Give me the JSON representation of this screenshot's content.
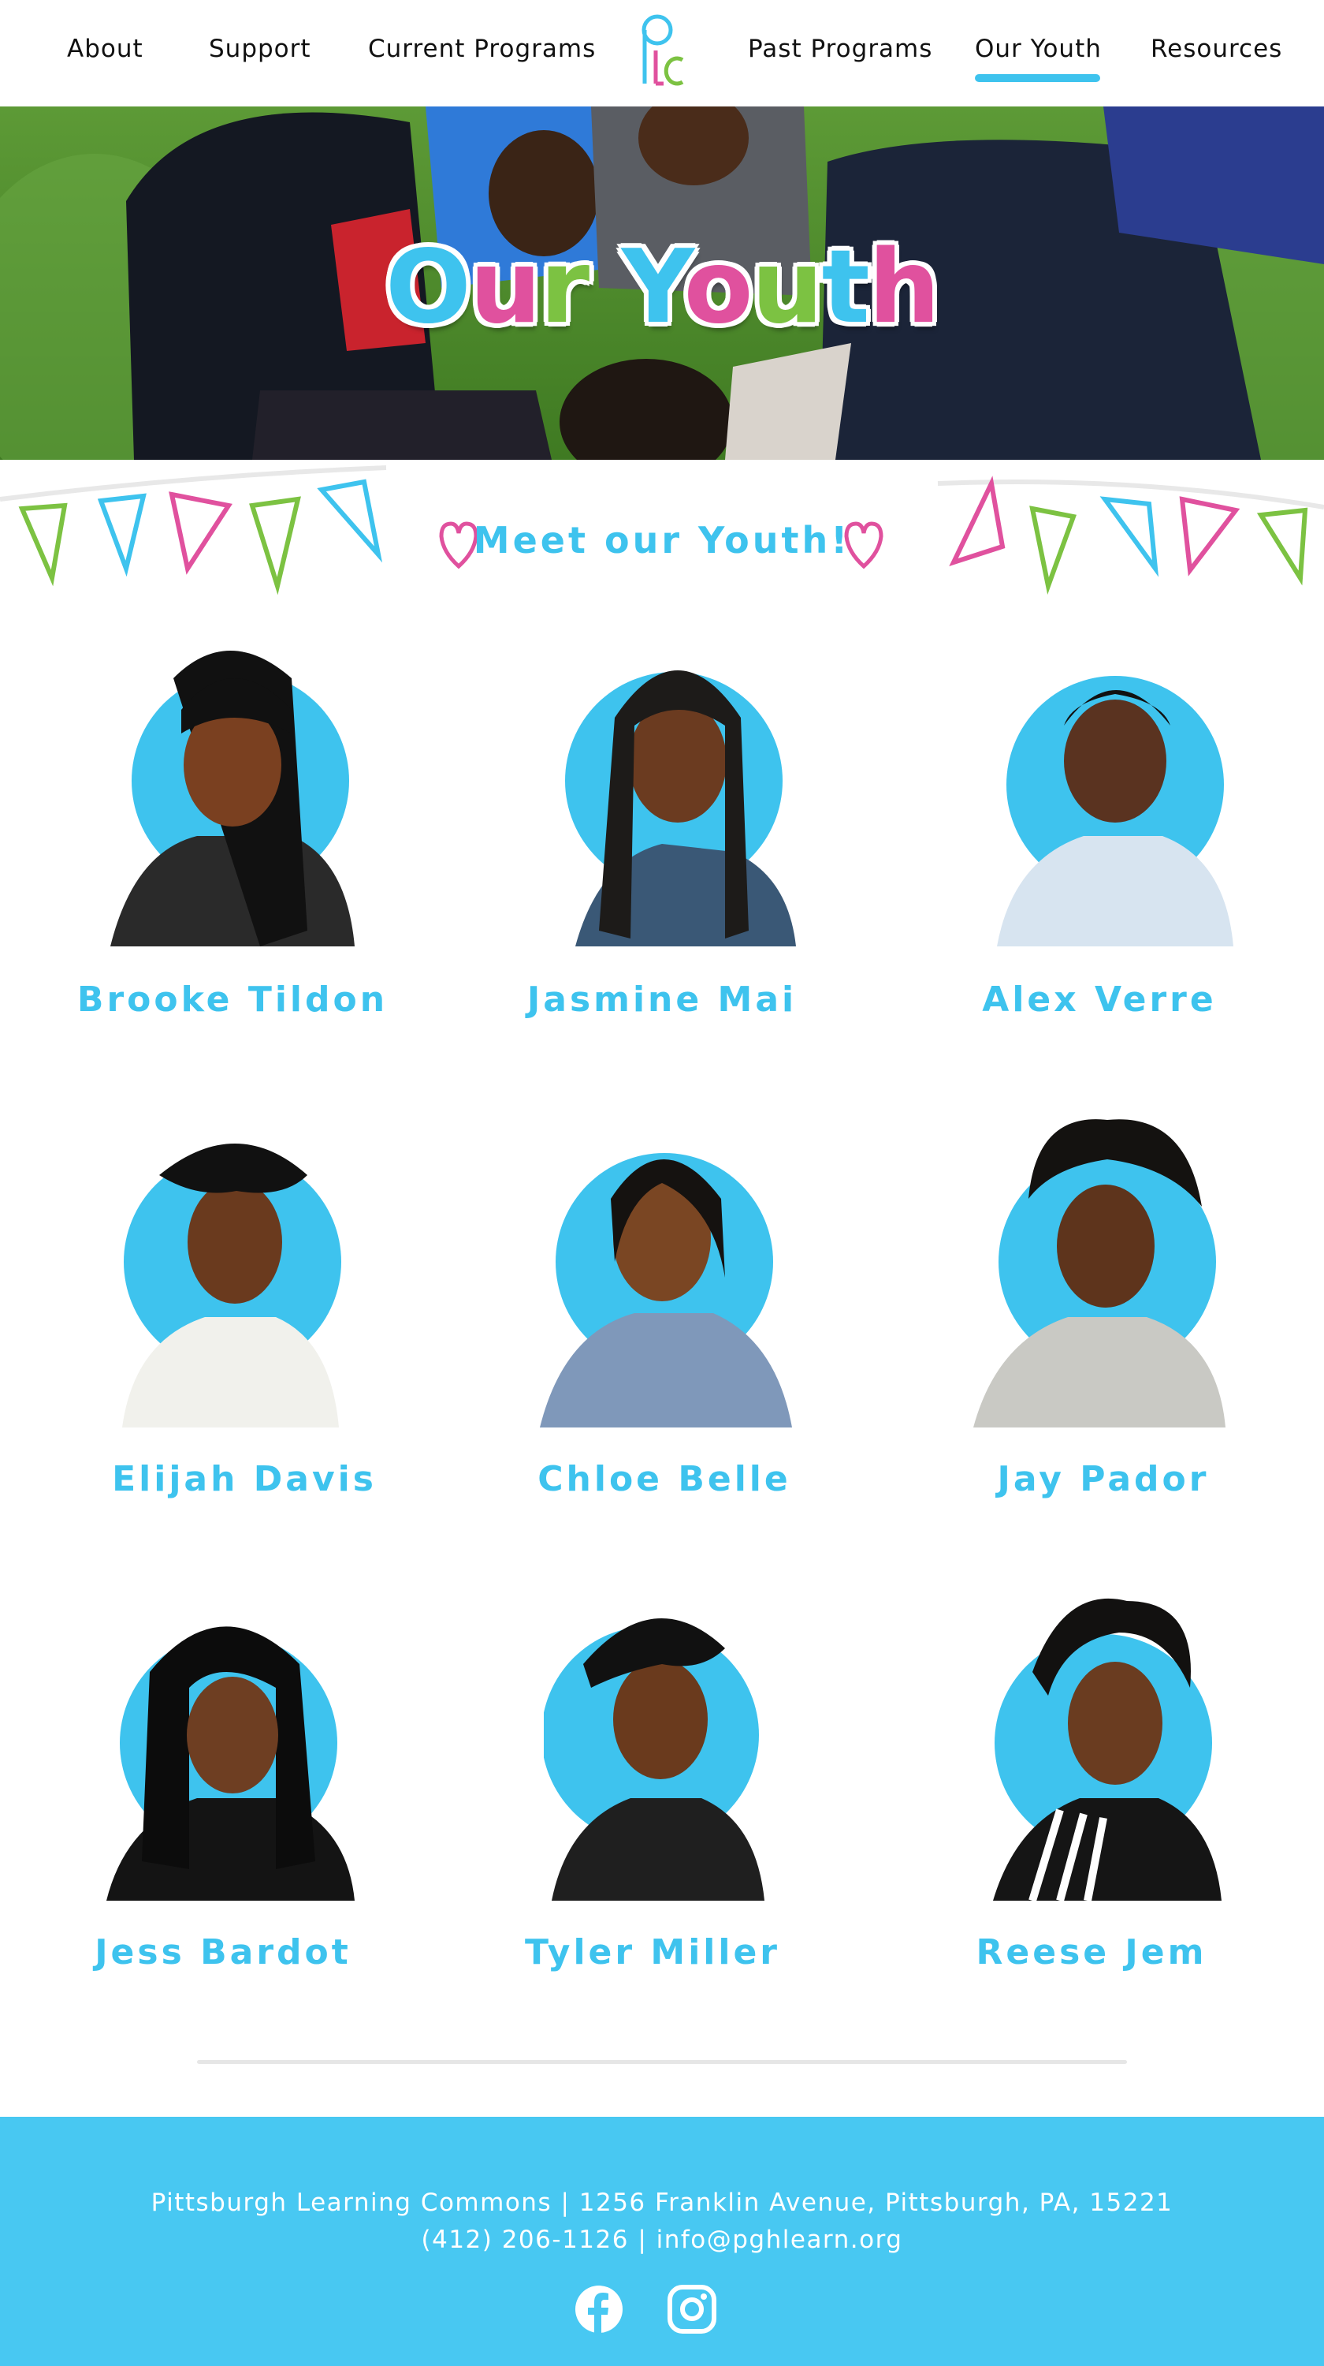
{
  "nav": {
    "items": [
      {
        "label": "About",
        "active": false
      },
      {
        "label": "Support",
        "active": false
      },
      {
        "label": "Current Programs",
        "active": false
      },
      {
        "label": "Past Programs",
        "active": false
      },
      {
        "label": "Our Youth",
        "active": true
      },
      {
        "label": "Resources",
        "active": false
      }
    ],
    "logo_text": "PLC"
  },
  "hero": {
    "title_letters": [
      "O",
      "u",
      "r",
      " ",
      "Y",
      "o",
      "u",
      "t",
      "h"
    ],
    "title": "Our Youth"
  },
  "section": {
    "title": "Meet our Youth!"
  },
  "youth": [
    {
      "name": "Brooke Tildon"
    },
    {
      "name": "Jasmine Mai"
    },
    {
      "name": "Alex Verre"
    },
    {
      "name": "Elijah Davis"
    },
    {
      "name": "Chloe Belle"
    },
    {
      "name": "Jay Pador"
    },
    {
      "name": "Jess Bardot"
    },
    {
      "name": "Tyler Miller"
    },
    {
      "name": "Reese Jem"
    }
  ],
  "footer": {
    "address": "Pittsburgh Learning Commons | 1256 Franklin Avenue, Pittsburgh, PA, 15221",
    "contact": "(412) 206-1126 | info@pghlearn.org",
    "social": [
      "facebook-icon",
      "instagram-icon"
    ]
  },
  "colors": {
    "accent_blue": "#3ec3ee",
    "pink": "#e0519e",
    "green": "#7cc242",
    "footer_bg": "#48c8f2"
  }
}
